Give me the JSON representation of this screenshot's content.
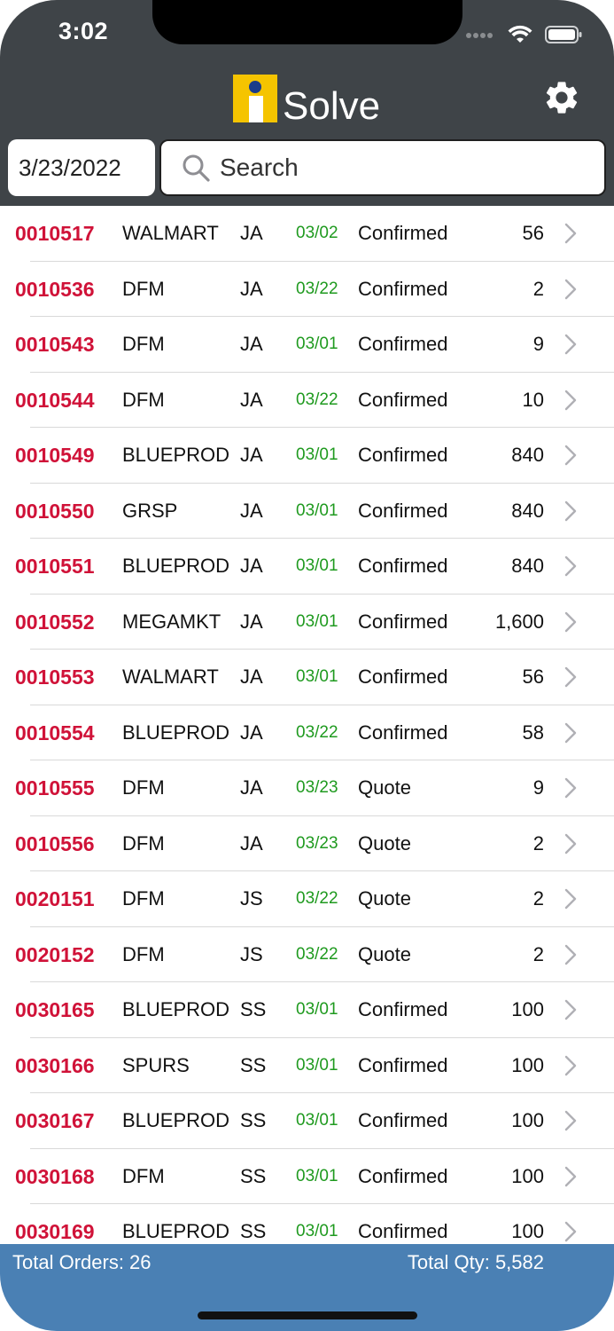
{
  "status_bar": {
    "time": "3:02"
  },
  "header": {
    "logo_text": "Solve",
    "settings_icon": "gear-icon",
    "date": "3/23/2022",
    "search": {
      "placeholder": "Search",
      "value": "",
      "icon": "search-icon"
    }
  },
  "colors": {
    "header_bg": "#3f4448",
    "order_number": "#d01238",
    "date_green": "#1f9a1f",
    "footer_bg": "#4a80b4",
    "logo_yellow": "#f5c400"
  },
  "orders": [
    {
      "order": "0010517",
      "customer": "WALMART",
      "initials": "JA",
      "date": "03/02",
      "status": "Confirmed",
      "qty": "56"
    },
    {
      "order": "0010536",
      "customer": "DFM",
      "initials": "JA",
      "date": "03/22",
      "status": "Confirmed",
      "qty": "2"
    },
    {
      "order": "0010543",
      "customer": "DFM",
      "initials": "JA",
      "date": "03/01",
      "status": "Confirmed",
      "qty": "9"
    },
    {
      "order": "0010544",
      "customer": "DFM",
      "initials": "JA",
      "date": "03/22",
      "status": "Confirmed",
      "qty": "10"
    },
    {
      "order": "0010549",
      "customer": "BLUEPROD",
      "initials": "JA",
      "date": "03/01",
      "status": "Confirmed",
      "qty": "840"
    },
    {
      "order": "0010550",
      "customer": "GRSP",
      "initials": "JA",
      "date": "03/01",
      "status": "Confirmed",
      "qty": "840"
    },
    {
      "order": "0010551",
      "customer": "BLUEPROD",
      "initials": "JA",
      "date": "03/01",
      "status": "Confirmed",
      "qty": "840"
    },
    {
      "order": "0010552",
      "customer": "MEGAMKT",
      "initials": "JA",
      "date": "03/01",
      "status": "Confirmed",
      "qty": "1,600"
    },
    {
      "order": "0010553",
      "customer": "WALMART",
      "initials": "JA",
      "date": "03/01",
      "status": "Confirmed",
      "qty": "56"
    },
    {
      "order": "0010554",
      "customer": "BLUEPROD",
      "initials": "JA",
      "date": "03/22",
      "status": "Confirmed",
      "qty": "58"
    },
    {
      "order": "0010555",
      "customer": "DFM",
      "initials": "JA",
      "date": "03/23",
      "status": "Quote",
      "qty": "9"
    },
    {
      "order": "0010556",
      "customer": "DFM",
      "initials": "JA",
      "date": "03/23",
      "status": "Quote",
      "qty": "2"
    },
    {
      "order": "0020151",
      "customer": "DFM",
      "initials": "JS",
      "date": "03/22",
      "status": "Quote",
      "qty": "2"
    },
    {
      "order": "0020152",
      "customer": "DFM",
      "initials": "JS",
      "date": "03/22",
      "status": "Quote",
      "qty": "2"
    },
    {
      "order": "0030165",
      "customer": "BLUEPROD",
      "initials": "SS",
      "date": "03/01",
      "status": "Confirmed",
      "qty": "100"
    },
    {
      "order": "0030166",
      "customer": "SPURS",
      "initials": "SS",
      "date": "03/01",
      "status": "Confirmed",
      "qty": "100"
    },
    {
      "order": "0030167",
      "customer": "BLUEPROD",
      "initials": "SS",
      "date": "03/01",
      "status": "Confirmed",
      "qty": "100"
    },
    {
      "order": "0030168",
      "customer": "DFM",
      "initials": "SS",
      "date": "03/01",
      "status": "Confirmed",
      "qty": "100"
    },
    {
      "order": "0030169",
      "customer": "BLUEPROD",
      "initials": "SS",
      "date": "03/01",
      "status": "Confirmed",
      "qty": "100"
    }
  ],
  "footer": {
    "total_orders": "Total Orders: 26",
    "total_qty": "Total Qty: 5,582"
  }
}
